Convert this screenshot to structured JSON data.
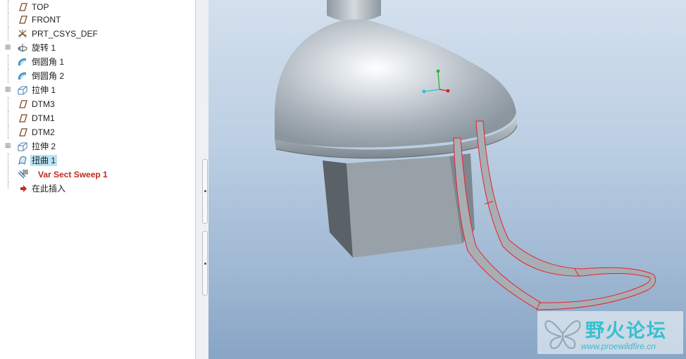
{
  "model_tree": {
    "items": [
      {
        "label": "TOP",
        "icon": "datum-plane-icon"
      },
      {
        "label": "FRONT",
        "icon": "datum-plane-icon"
      },
      {
        "label": "PRT_CSYS_DEF",
        "icon": "coordinate-system-icon"
      },
      {
        "label": "旋转 1",
        "icon": "revolve-icon",
        "expandable": true
      },
      {
        "label": "倒圆角 1",
        "icon": "round-icon"
      },
      {
        "label": "倒圆角 2",
        "icon": "round-icon"
      },
      {
        "label": "拉伸 1",
        "icon": "extrude-icon",
        "expandable": true
      },
      {
        "label": "DTM3",
        "icon": "datum-plane-icon"
      },
      {
        "label": "DTM1",
        "icon": "datum-plane-icon"
      },
      {
        "label": "DTM2",
        "icon": "datum-plane-icon"
      },
      {
        "label": "拉伸 2",
        "icon": "extrude-icon",
        "expandable": true
      },
      {
        "label": "扭曲 1",
        "icon": "warp-icon",
        "selected": true
      },
      {
        "label": "Var Sect Sweep 1",
        "icon": "var-sect-sweep-icon",
        "status": "failed"
      },
      {
        "label": "在此插入",
        "icon": "insert-here-arrow-icon"
      }
    ]
  },
  "colors": {
    "selection": "#b8e3f4",
    "failed_feature": "#c0281c",
    "viewport_top": "#d3e0ee",
    "viewport_bottom": "#88a5c6",
    "edge_highlight": "#e8202a"
  },
  "watermark": {
    "text_cn": "野火论坛",
    "url": "www.proewildfire.cn"
  }
}
